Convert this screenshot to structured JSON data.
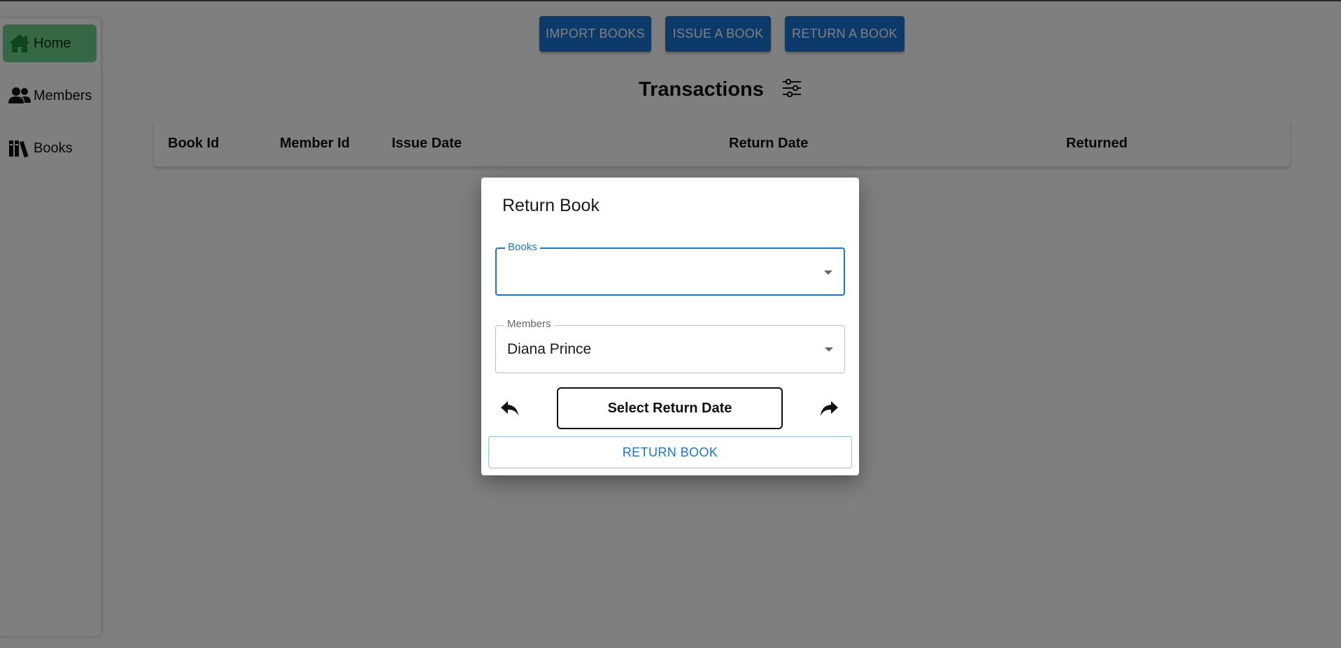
{
  "sidebar": {
    "items": [
      {
        "label": "Home",
        "icon": "home-icon",
        "active": true
      },
      {
        "label": "Members",
        "icon": "members-icon",
        "active": false
      },
      {
        "label": "Books",
        "icon": "books-icon",
        "active": false
      }
    ]
  },
  "toolbar": {
    "import_label": "IMPORT BOOKS",
    "issue_label": "ISSUE A BOOK",
    "return_label": "RETURN A BOOK"
  },
  "page": {
    "title": "Transactions",
    "filter_icon": "filter-sliders-icon"
  },
  "table": {
    "columns": [
      "Book Id",
      "Member Id",
      "Issue Date",
      "Return Date",
      "Returned"
    ],
    "rows": []
  },
  "dialog": {
    "title": "Return Book",
    "books_field": {
      "label": "Books",
      "value": ""
    },
    "members_field": {
      "label": "Members",
      "value": "Diana Prince"
    },
    "undo_icon": "undo-arrow-icon",
    "redo_icon": "redo-arrow-icon",
    "date_button_label": "Select Return Date",
    "submit_label": "RETURN BOOK"
  },
  "colors": {
    "primary": "#1976d2",
    "active_nav": "#6fd08b",
    "overlay": "rgba(0,0,0,0.5)"
  }
}
